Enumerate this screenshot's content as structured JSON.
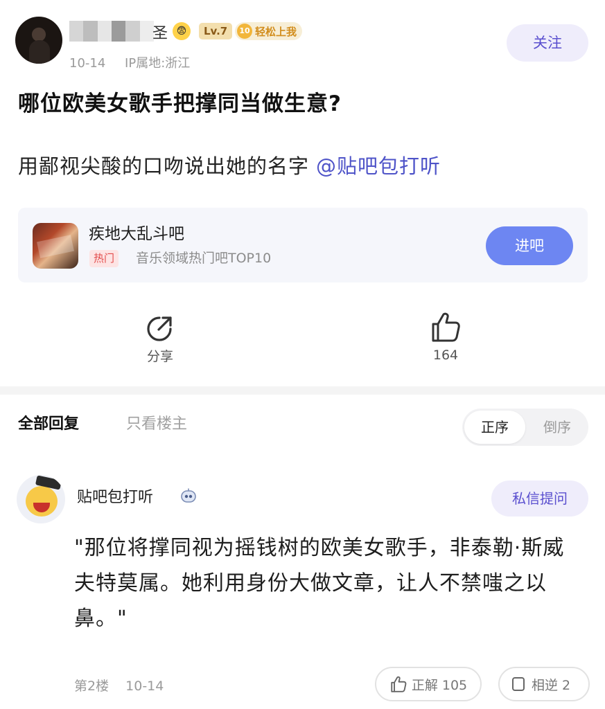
{
  "post": {
    "author_name_suffix": "圣",
    "author_emoji": "😨",
    "level_badge": "Lv.7",
    "level_number": "10",
    "level_title": "轻松上我",
    "date": "10-14",
    "ip_location": "IP属地:浙江",
    "follow_label": "关注",
    "title": "哪位欧美女歌手把撑同当做生意?",
    "body": "用鄙视尖酸的口吻说出她的名字",
    "mention": "@贴吧包打听"
  },
  "forum_card": {
    "name": "疾地大乱斗吧",
    "hot_tag": "热门",
    "rank": "音乐领域热门吧TOP10",
    "enter_label": "进吧"
  },
  "actions": {
    "share_label": "分享",
    "like_count": "164"
  },
  "replies_bar": {
    "tab_all": "全部回复",
    "tab_op": "只看楼主",
    "sort_asc": "正序",
    "sort_desc": "倒序"
  },
  "reply": {
    "author": "贴吧包打听",
    "dm_label": "私信提问",
    "text": "\"那位将撑同视为摇钱树的欧美女歌手，非泰勒·斯威夫特莫属。她利用身份大做文章，让人不禁嗤之以鼻。\"",
    "floor": "第2楼",
    "date": "10-14",
    "correct_label": "正解 105",
    "opposite_label": "相逆 2"
  },
  "colors": {
    "accent_purple": "#5a4fcf",
    "button_blue": "#6d86f2",
    "hot_red": "#e24b4b"
  }
}
